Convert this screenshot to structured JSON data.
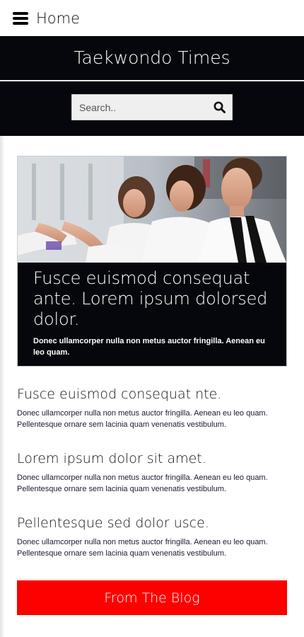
{
  "nav": {
    "menu_label": "Home",
    "icon": "hamburger-icon"
  },
  "header": {
    "title": "Taekwondo Times"
  },
  "search": {
    "placeholder": "Search..",
    "icon": "search-icon"
  },
  "hero": {
    "image": "martial-arts-class-photo",
    "title": "Fusce euismod consequat ante. Lorem ipsum dolorsed dolor.",
    "text": "Donec ullamcorper nulla non metus auctor fringilla. Aenean eu leo quam."
  },
  "articles": [
    {
      "title": "Fusce euismod consequat nte.",
      "text": "Donec ullamcorper nulla non metus auctor fringilla. Aenean eu leo quam. Pellentesque ornare sem lacinia quam venenatis vestibulum."
    },
    {
      "title": "Lorem ipsum dolor sit amet.",
      "text": "Donec ullamcorper nulla non metus auctor fringilla. Aenean eu leo quam. Pellentesque ornare sem lacinia quam venenatis vestibulum."
    },
    {
      "title": "Pellentesque sed dolor usce.",
      "text": "Donec ullamcorper nulla non metus auctor fringilla. Aenean eu leo quam. Pellentesque ornare sem lacinia quam venenatis vestibulum."
    }
  ],
  "blog_button": {
    "label": "From The Blog"
  },
  "colors": {
    "dark": "#06070c",
    "accent": "#fd0000"
  }
}
